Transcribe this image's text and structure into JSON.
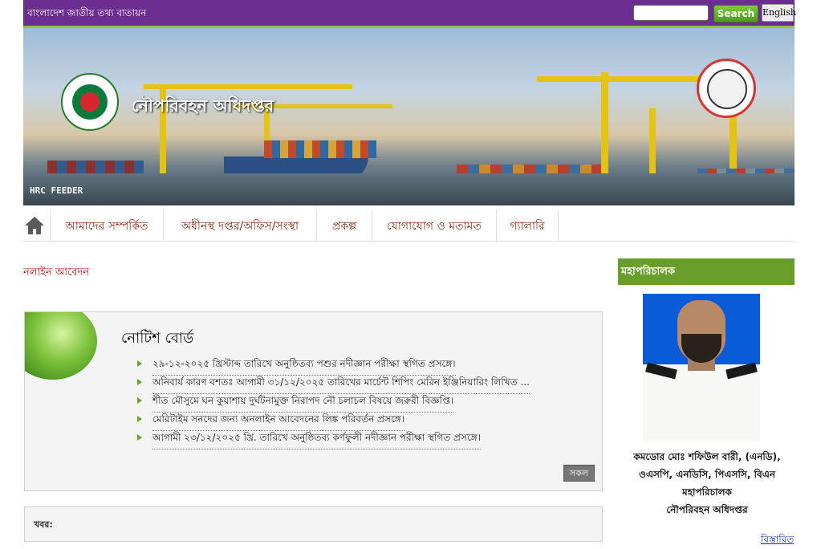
{
  "topbar": {
    "portal_label": "বাংলাদেশ জাতীয় তথ্য বাতায়ন",
    "search_placeholder": "",
    "search_button": "Search",
    "language_button": "English"
  },
  "banner": {
    "title": "নৌপরিবহন অধিদপ্তর",
    "ship_label": "HRC FEEDER"
  },
  "nav": {
    "items": [
      {
        "label": "আমাদের সম্পর্কিত"
      },
      {
        "label": "অধীনস্থ দপ্তর/অফিস/সংস্থা"
      },
      {
        "label": "প্রকল্প"
      },
      {
        "label": "যোগাযোগ ও মতামত"
      },
      {
        "label": "গ্যালারি"
      }
    ]
  },
  "apply_link": "নলাইন আবেদন",
  "notice_board": {
    "title": "নোটিশ বোর্ড",
    "items": [
      "২৯-১২-২০২৫ খ্রিস্টাব্দ তারিখে অনুষ্ঠিতব্য পশুর নদীজ্ঞান পরীক্ষা স্থগিত প্রসঙ্গে।",
      "অনিবার্য কারণ বশতঃ আগামী ৩১/১২/২০২৫ তারিখের মার্চেন্ট শিপিং মেরিন ইঞ্জিনিয়ারিং লিখিত ...",
      "শীত মৌসুমে ঘন কুয়াশায় দুর্ঘটনামুক্ত নিরাপদ নৌ চলাচল বিষয়ে জরুরী বিজ্ঞপ্তি।",
      "মেরিটাইম সনদের জন্য অনলাইন আবেদনের লিঙ্ক পরিবর্তন প্রসঙ্গে।",
      "আগামী ২৩/১২/২০২৫ খ্রি. তারিখে অনুষ্ঠিতব্য কর্ণফুলী নদীজ্ঞান পরীক্ষা স্থগিত প্রসঙ্গে।"
    ],
    "all_button": "সকল"
  },
  "news": {
    "label": "খবর:"
  },
  "director_general": {
    "header": "মহাপরিচালক",
    "name_line1": "কমডোর মোঃ শফিউল বারী, (এনডি),",
    "name_line2": "ওএসপি, এনডিসি, পিএসসি, বিএন",
    "designation": "মহাপরিচালক",
    "office": "নৌপরিবহন অধিদপ্তর",
    "more_link": "বিস্তারিত"
  },
  "colors": {
    "topbar": "#6b2d8f",
    "accent_green": "#6a9e2b",
    "nav_text": "#8a2b12"
  }
}
